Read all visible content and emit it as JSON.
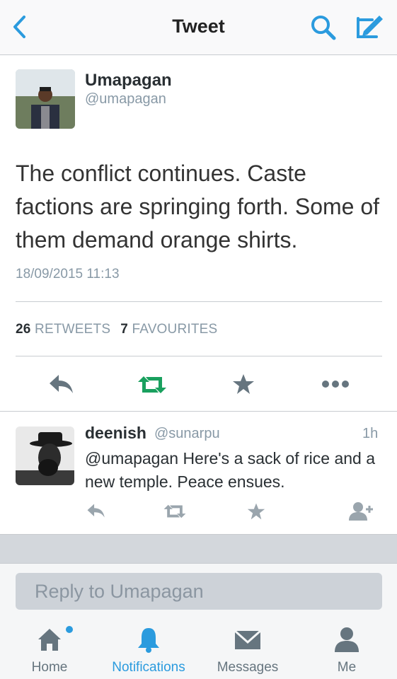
{
  "nav": {
    "title": "Tweet",
    "back_icon": "chevron-left-icon",
    "search_icon": "search-icon",
    "compose_icon": "compose-icon"
  },
  "tweet": {
    "author_name": "Umapagan",
    "author_handle": "@umapagan",
    "text": "The conflict continues. Caste factions are springing forth. Some of them demand orange shirts.",
    "timestamp": "18/09/2015 11:13",
    "retweets_count": "26",
    "retweets_label": "RETWEETS",
    "favourites_count": "7",
    "favourites_label": "FAVOURITES"
  },
  "reply": {
    "name": "deenish",
    "handle": "@sunarpu",
    "time": "1h",
    "text": "@umapagan Here's a sack of rice and a new temple. Peace ensues."
  },
  "composer": {
    "placeholder": "Reply to Umapagan"
  },
  "tabs": [
    {
      "label": "Home",
      "icon": "home-icon"
    },
    {
      "label": "Notifications",
      "icon": "bell-icon"
    },
    {
      "label": "Messages",
      "icon": "envelope-icon"
    },
    {
      "label": "Me",
      "icon": "person-icon"
    }
  ],
  "colors": {
    "accent": "#2b9bde",
    "retweet_green": "#19a05e",
    "icon_gray": "#66757f",
    "muted_text": "#8899a6"
  }
}
